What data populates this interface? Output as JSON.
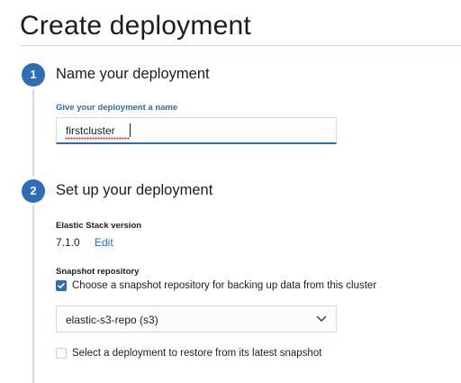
{
  "page": {
    "title": "Create deployment"
  },
  "steps": [
    {
      "number": "1",
      "title": "Name your deployment",
      "name_field": {
        "label": "Give your deployment a name",
        "value": "firstcluster"
      }
    },
    {
      "number": "2",
      "title": "Set up your deployment",
      "stack_version": {
        "label": "Elastic Stack version",
        "value": "7.1.0",
        "edit_label": "Edit"
      },
      "snapshot": {
        "label": "Snapshot repository",
        "choose_repo_checkbox": {
          "label": "Choose a snapshot repository for backing up data from this cluster",
          "checked": true
        },
        "repository_select": {
          "value": "elastic-s3-repo (s3)"
        },
        "restore_checkbox": {
          "label": "Select a deployment to restore from its latest snapshot",
          "checked": false
        }
      }
    }
  ],
  "colors": {
    "accent": "#2c6db5",
    "text": "#1a1c21",
    "border": "#d3dae6",
    "spellcheck": "#e0342c"
  }
}
